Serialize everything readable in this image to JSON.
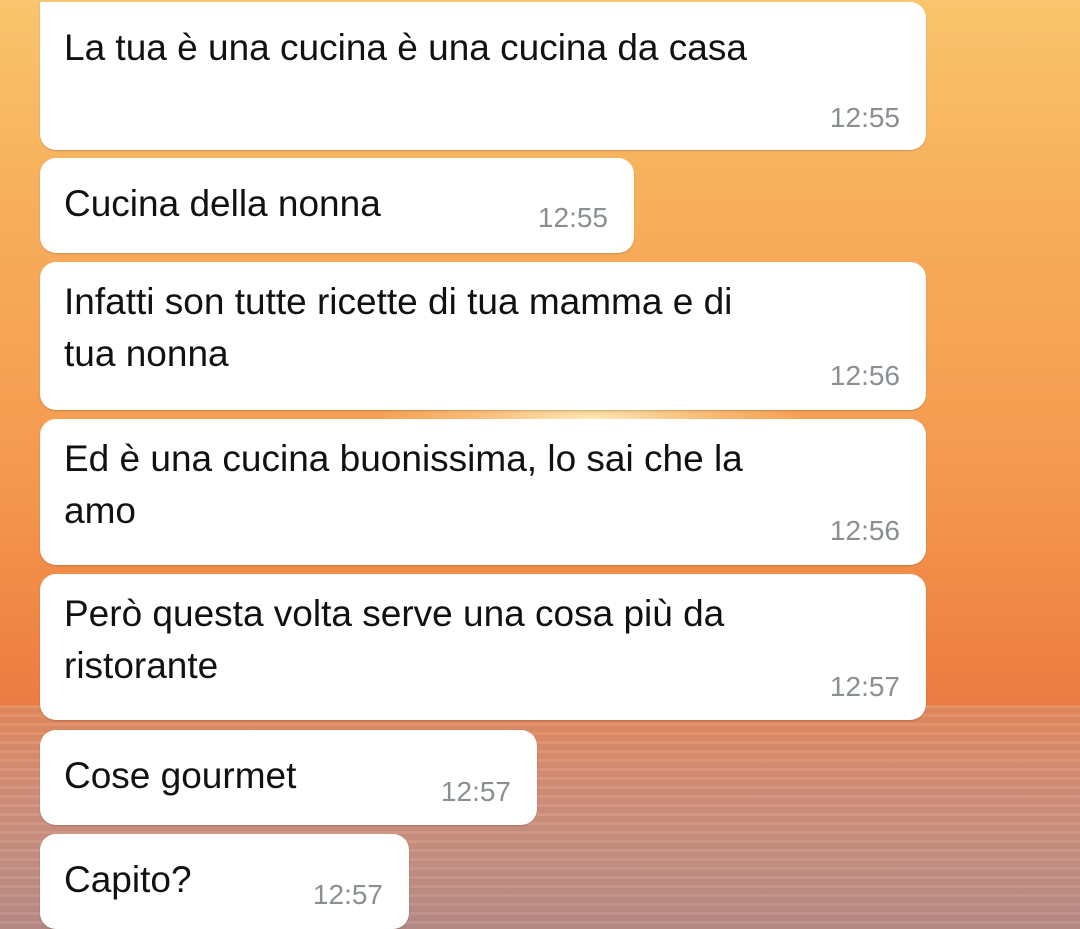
{
  "chat": {
    "messages": [
      {
        "text_lines": [
          "La tua è una cucina è una cucina da casa"
        ],
        "time": "12:55"
      },
      {
        "text_lines": [
          "Cucina della nonna"
        ],
        "time": "12:55"
      },
      {
        "text_lines": [
          "Infatti son tutte ricette di tua mamma e di",
          "tua nonna"
        ],
        "time": "12:56"
      },
      {
        "text_lines": [
          "Ed è una cucina buonissima, lo sai che la",
          "amo"
        ],
        "time": "12:56"
      },
      {
        "text_lines": [
          "Però questa volta serve una cosa più da",
          "ristorante"
        ],
        "time": "12:57"
      },
      {
        "text_lines": [
          "Cose gourmet"
        ],
        "time": "12:57"
      },
      {
        "text_lines": [
          "Capito?"
        ],
        "time": "12:57"
      }
    ]
  },
  "colors": {
    "bubble_background": "#ffffff",
    "message_text": "#111111",
    "timestamp_text": "#8a8f93",
    "wallpaper_sky": "#f6a556",
    "wallpaper_sea": "#c69080"
  },
  "icons": {
    "bubble_tail": "incoming-bubble-tail-icon"
  }
}
